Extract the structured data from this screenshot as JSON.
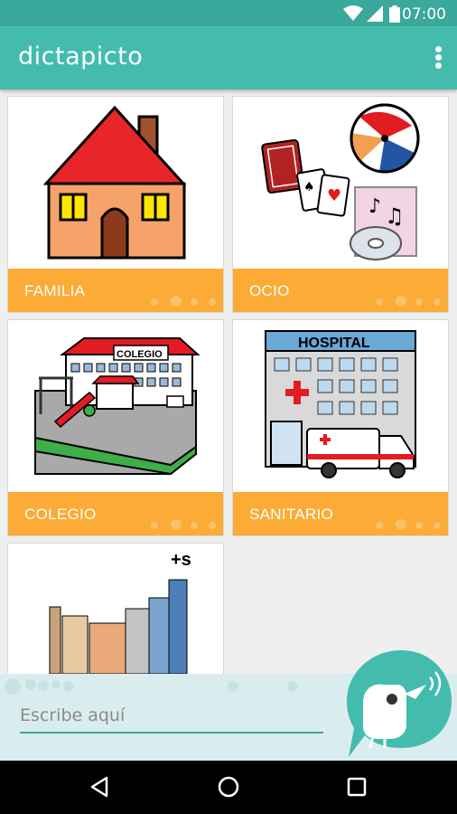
{
  "status_bar": {
    "time": "07:00",
    "icons": [
      "wifi-icon",
      "cell-signal-icon",
      "battery-icon"
    ]
  },
  "app_bar": {
    "title": "dictapicto",
    "menu_icon": "more-vert-icon"
  },
  "categories": [
    {
      "label": "FAMILIA",
      "icon": "house-icon"
    },
    {
      "label": "OCIO",
      "icon": "leisure-icon"
    },
    {
      "label": "COLEGIO",
      "icon": "school-icon",
      "sign_text": "COLEGIO"
    },
    {
      "label": "SANITARIO",
      "icon": "hospital-icon",
      "sign_text": "HOSPITAL"
    },
    {
      "label": "",
      "icon": "street-icon",
      "badge_text": "+s"
    }
  ],
  "input": {
    "placeholder": "Escribe aquí",
    "value": ""
  },
  "speak_button": {
    "icon": "speaking-bird-icon"
  },
  "nav": {
    "icons": [
      "back-icon",
      "home-icon",
      "recents-icon"
    ]
  },
  "colors": {
    "primary": "#43bcae",
    "primary_dark": "#3aa89a",
    "label_orange": "#fbab36",
    "panel": "#daedee"
  }
}
